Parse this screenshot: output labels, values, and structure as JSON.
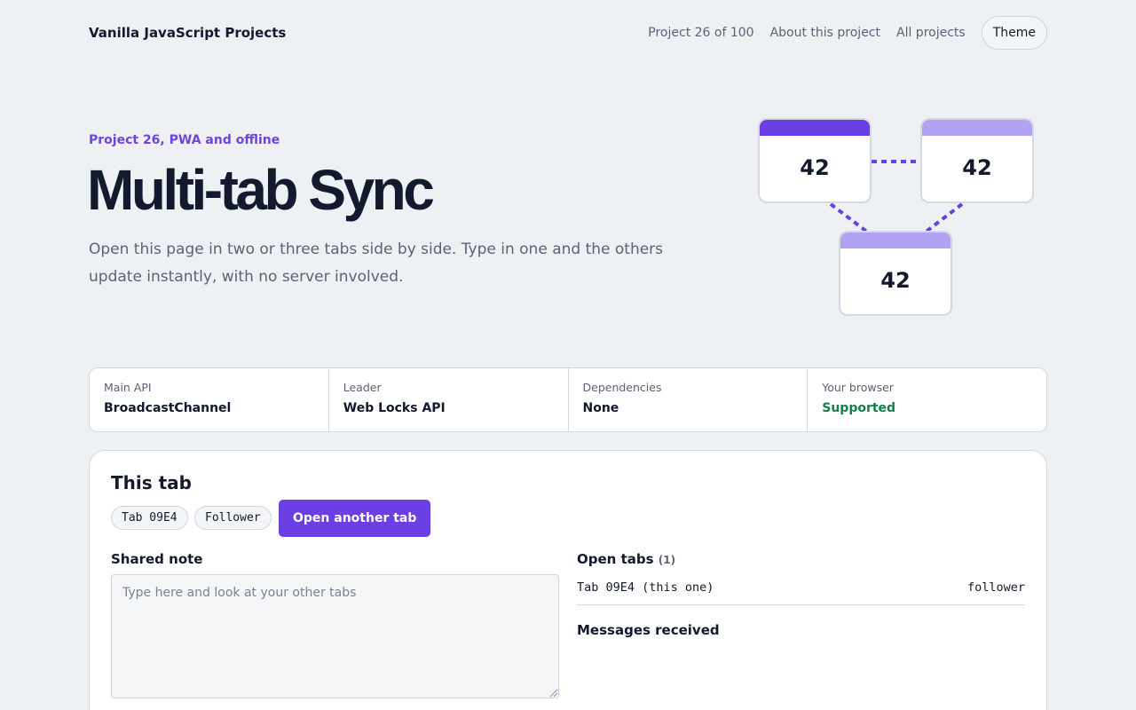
{
  "header": {
    "brand": "Vanilla JavaScript Projects",
    "nav": {
      "progress": "Project 26 of 100",
      "about": "About this project",
      "all": "All projects",
      "theme": "Theme"
    }
  },
  "hero": {
    "eyebrow": "Project 26, PWA and offline",
    "title": "Multi-tab Sync",
    "lead": "Open this page in two or three tabs side by side. Type in one and the others update instantly, with no server involved."
  },
  "illustration": {
    "values": [
      "42",
      "42",
      "42"
    ],
    "colors": {
      "primary": "#6b3fe4",
      "light": "#b3a2f3",
      "link": "#6b3fe4"
    }
  },
  "stats": [
    {
      "label": "Main API",
      "value": "BroadcastChannel"
    },
    {
      "label": "Leader",
      "value": "Web Locks API"
    },
    {
      "label": "Dependencies",
      "value": "None"
    },
    {
      "label": "Your browser",
      "value": "Supported",
      "color": "#128048"
    }
  ],
  "panel": {
    "title": "This tab",
    "tab_id": "Tab 09E4",
    "role": "Follower",
    "open_button": "Open another tab",
    "note": {
      "title": "Shared note",
      "value": "",
      "placeholder": "Type here and look at your other tabs"
    },
    "open_tabs": {
      "title": "Open tabs",
      "count": "(1)",
      "rows": [
        {
          "name": "Tab 09E4 (this one)",
          "role": "follower"
        }
      ]
    },
    "messages_title": "Messages received"
  }
}
